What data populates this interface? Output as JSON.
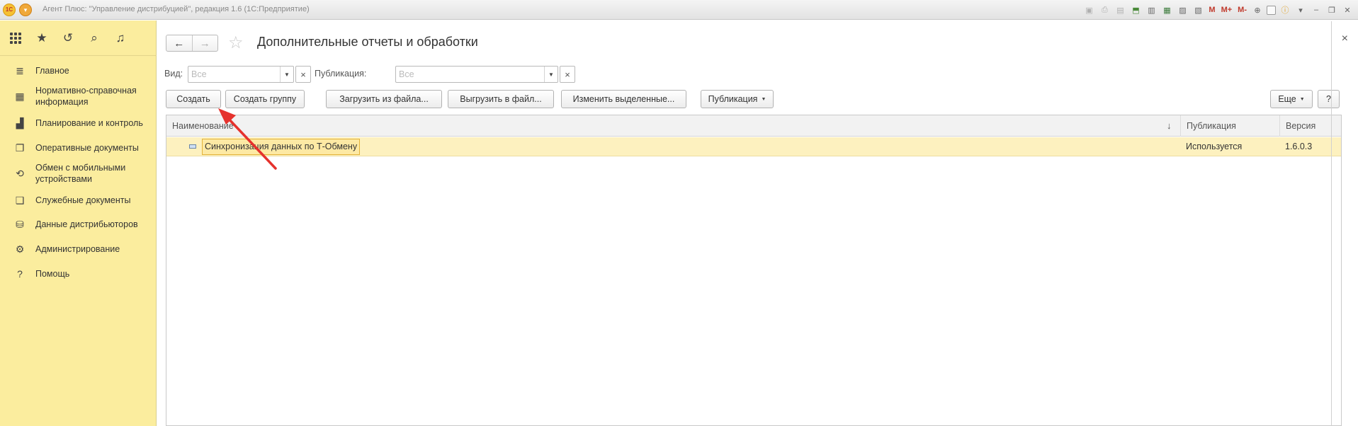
{
  "window": {
    "title": "Агент Плюс: \"Управление дистрибуцией\", редакция 1.6  (1С:Предприятие)",
    "logo_text": "1С",
    "title_menu_glyph": "▾",
    "toolbar_letters": {
      "m": "M",
      "m_plus": "M+",
      "m_minus": "M-"
    }
  },
  "sidebar": {
    "items": [
      {
        "label": "Главное",
        "icon": "list-icon",
        "glyph": "≣"
      },
      {
        "label": "Нормативно-справочная информация",
        "icon": "table-icon",
        "glyph": "▦"
      },
      {
        "label": "Планирование и контроль",
        "icon": "bar-chart-icon",
        "glyph": "▟"
      },
      {
        "label": "Оперативные документы",
        "icon": "documents-icon",
        "glyph": "❐"
      },
      {
        "label": "Обмен с мобильными устройствами",
        "icon": "sync-icon",
        "glyph": "⟲"
      },
      {
        "label": "Служебные документы",
        "icon": "service-docs-icon",
        "glyph": "❑"
      },
      {
        "label": "Данные дистрибьюторов",
        "icon": "distributor-icon",
        "glyph": "⛁"
      },
      {
        "label": "Администрирование",
        "icon": "gear-icon",
        "glyph": "⚙"
      },
      {
        "label": "Помощь",
        "icon": "help-icon",
        "glyph": "?"
      }
    ]
  },
  "form": {
    "title": "Дополнительные отчеты и обработки",
    "close_glyph": "×",
    "filters": {
      "vid_label": "Вид:",
      "vid_placeholder": "Все",
      "pub_label": "Публикация:",
      "pub_placeholder": "Все",
      "clear_glyph": "×"
    },
    "buttons": {
      "create": "Создать",
      "create_group": "Создать группу",
      "load_from_file": "Загрузить из файла...",
      "unload_to_file": "Выгрузить в файл...",
      "change_selected": "Изменить выделенные...",
      "publication": "Публикация",
      "more": "Еще",
      "help": "?"
    },
    "table": {
      "columns": {
        "name": "Наименование",
        "publication": "Публикация",
        "version": "Версия"
      },
      "sort_glyph": "↓",
      "rows": [
        {
          "name": "Синхронизация данных по Т-Обмену",
          "publication": "Используется",
          "version": "1.6.0.3"
        }
      ]
    }
  },
  "colors": {
    "sidebar_bg": "#fbed9e",
    "selected_row": "#fdf1bf",
    "annotation_arrow": "#e5322d"
  }
}
